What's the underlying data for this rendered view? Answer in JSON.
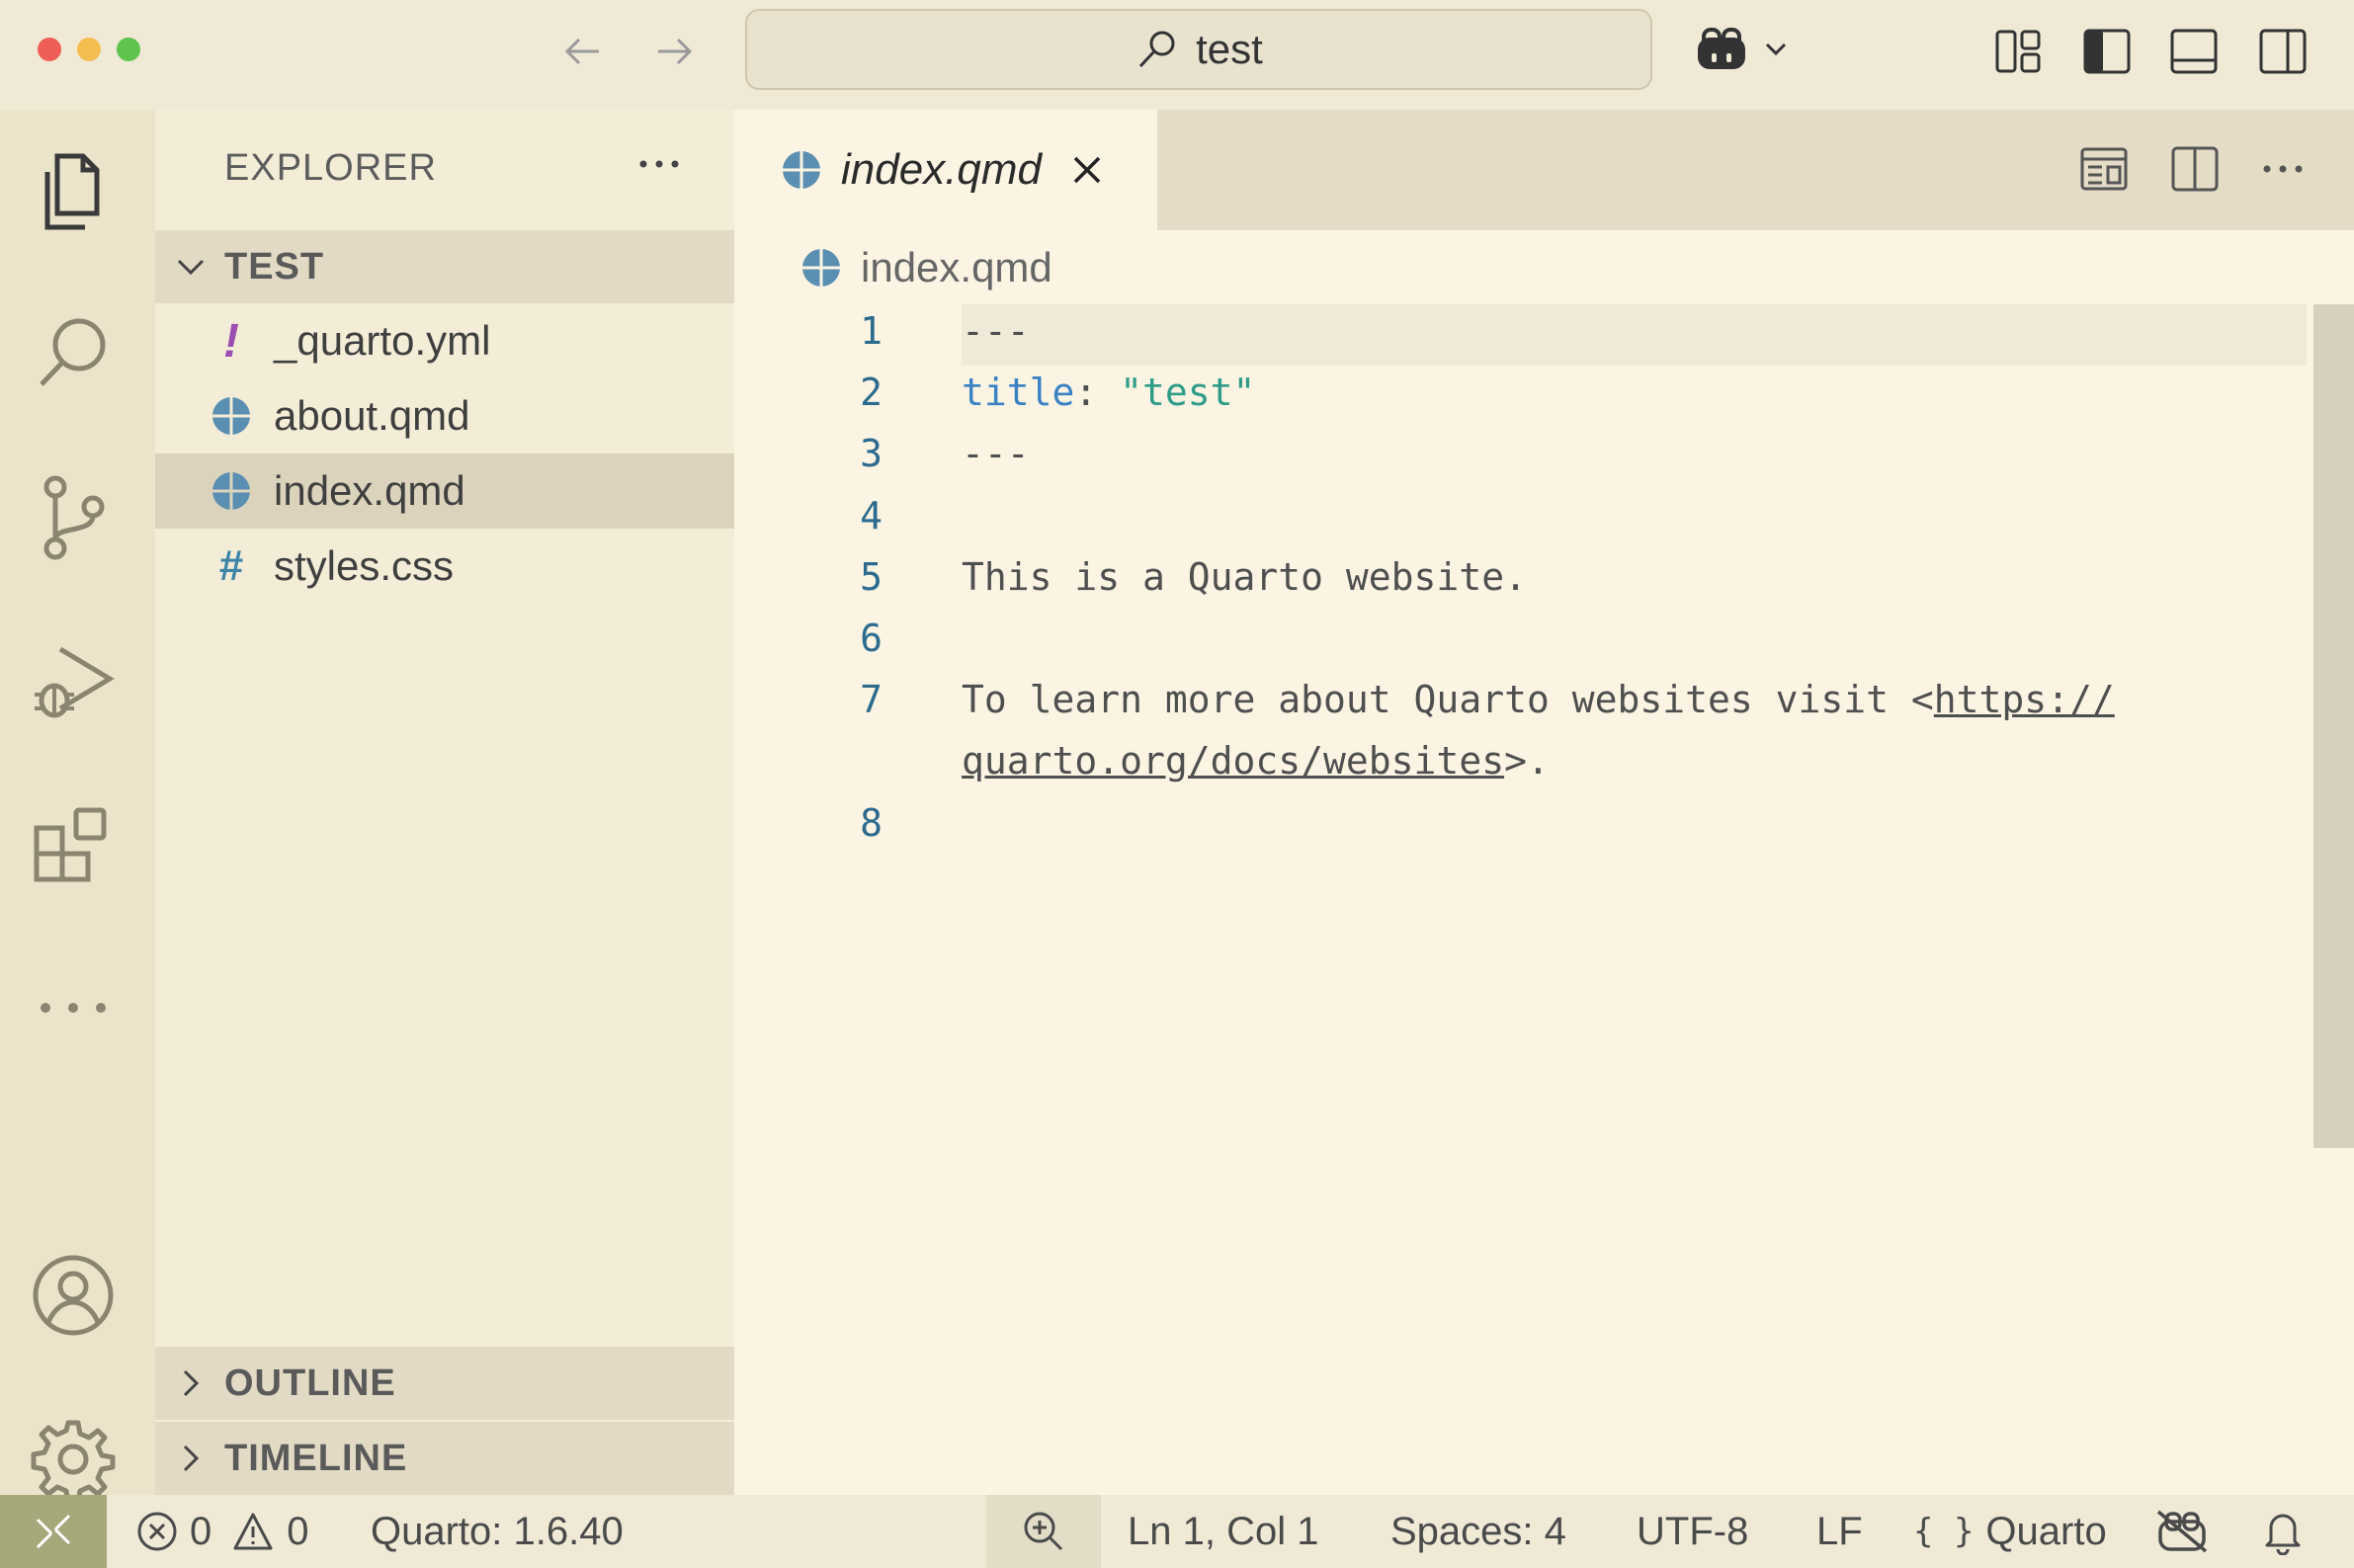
{
  "title_bar": {
    "search_text": "test",
    "icons": [
      "back-arrow-icon",
      "forward-arrow-icon",
      "search-icon",
      "copilot-icon",
      "chevron-down-icon",
      "customize-layout-icon",
      "toggle-sidebar-icon",
      "toggle-panel-icon",
      "toggle-secondary-sidebar-icon"
    ]
  },
  "activity_bar": {
    "items": [
      "explorer",
      "search",
      "source-control",
      "run-and-debug",
      "extensions",
      "more",
      "accounts",
      "manage"
    ]
  },
  "sidebar": {
    "header": "EXPLORER",
    "folder": "TEST",
    "files": [
      {
        "name": "_quarto.yml",
        "icon": "yaml-icon"
      },
      {
        "name": "about.qmd",
        "icon": "quarto-icon"
      },
      {
        "name": "index.qmd",
        "icon": "quarto-icon"
      },
      {
        "name": "styles.css",
        "icon": "css-icon"
      }
    ],
    "outline": "OUTLINE",
    "timeline": "TIMELINE"
  },
  "editor": {
    "tab_label": "index.qmd",
    "breadcrumb": "index.qmd",
    "line_numbers": [
      "1",
      "2",
      "3",
      "4",
      "5",
      "6",
      "7",
      "8"
    ],
    "lines": {
      "l1": "---",
      "l2_key": "title",
      "l2_colon": ": ",
      "l2_value": "\"test\"",
      "l3": "---",
      "l5": "This is a Quarto website.",
      "l7_text": "To learn more about Quarto websites visit <",
      "l7_link_a": "https://",
      "l7_link_b": "quarto.org/docs/websites",
      "l7_end": ">."
    }
  },
  "status_bar": {
    "errors": "0",
    "warnings": "0",
    "quarto_version": "Quarto: 1.6.40",
    "cursor": "Ln 1, Col 1",
    "spaces": "Spaces: 4",
    "encoding": "UTF-8",
    "eol": "LF",
    "language": "Quarto"
  },
  "colors": {
    "background": "#fbf4e3",
    "sidebar": "#f3ecd7",
    "activity_bar": "#ece4ca",
    "keyword": "#3a82c4",
    "string": "#2f9c88",
    "line_number": "#2c6a8e",
    "remote": "#a6a87a"
  }
}
